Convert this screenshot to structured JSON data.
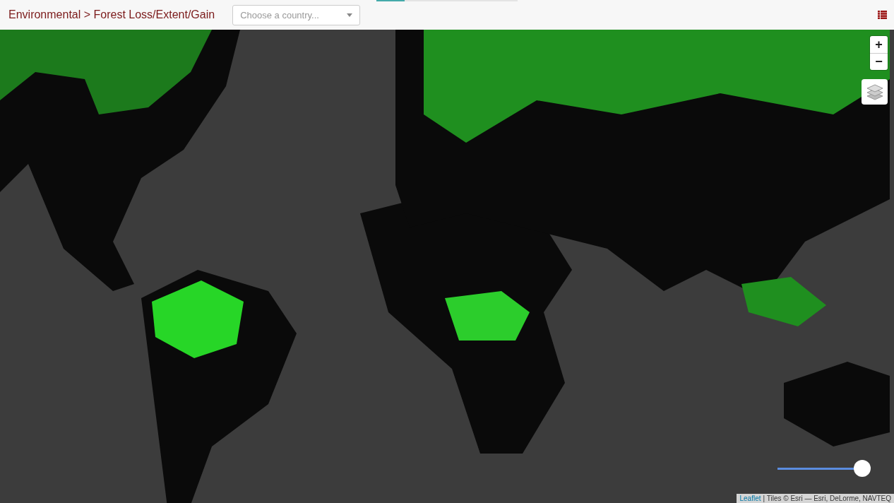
{
  "header": {
    "title": "Environmental > Forest Loss/Extent/Gain",
    "country_select": {
      "placeholder": "Choose a country..."
    },
    "loading_bar": {
      "level": 0.2
    }
  },
  "map": {
    "zoom_in": "+",
    "zoom_out": "−",
    "opacity_slider": {
      "level": 1.0
    },
    "attribution": {
      "link": "Leaflet",
      "text": "| Tiles © Esri — Esri, DeLorme, NAVTEQ"
    }
  }
}
